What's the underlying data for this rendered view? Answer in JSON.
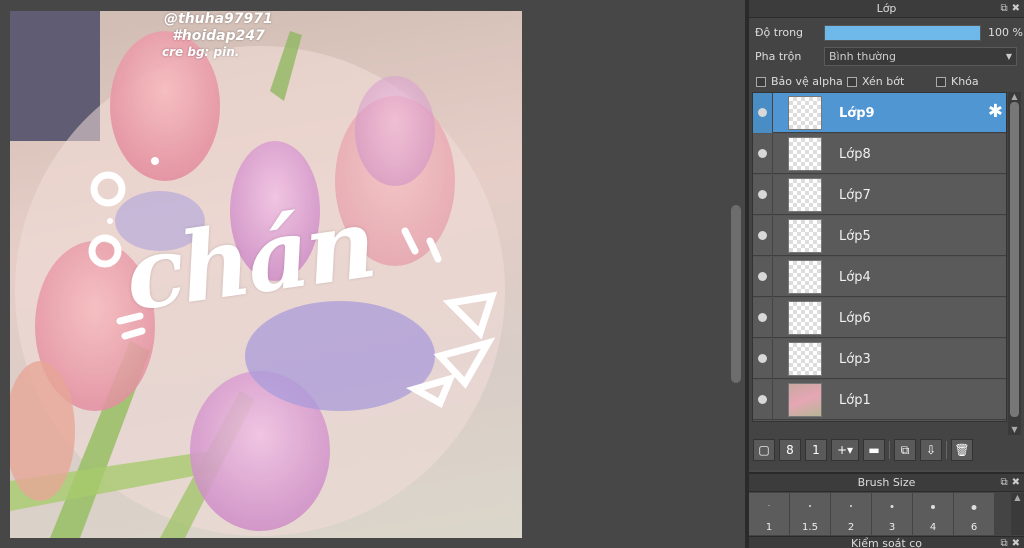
{
  "canvas": {
    "watermark": {
      "line1": "@thuha97971",
      "line2": "#hoidap247",
      "line3": "cre bg: pin."
    },
    "sticker_text": "chán"
  },
  "layer_panel": {
    "title": "Lớp",
    "opacity_label": "Độ trong",
    "opacity_value": "100 %",
    "opacity_level": 1.0,
    "blend_label": "Pha trộn",
    "blend_value": "Bình thường",
    "checkbox_alpha": "Bảo vệ alpha",
    "checkbox_clip": "Xén bớt",
    "checkbox_lock": "Khóa",
    "layers": [
      {
        "name": "Lớp9",
        "selected": true
      },
      {
        "name": "Lớp8",
        "selected": false
      },
      {
        "name": "Lớp7",
        "selected": false
      },
      {
        "name": "Lớp5",
        "selected": false
      },
      {
        "name": "Lớp4",
        "selected": false
      },
      {
        "name": "Lớp6",
        "selected": false
      },
      {
        "name": "Lớp3",
        "selected": false
      },
      {
        "name": "Lớp1",
        "selected": false
      }
    ],
    "toolbar_icons": [
      "new-layer-icon",
      "new-8bit-layer-icon",
      "new-1bit-layer-icon",
      "add-layer-menu-icon",
      "folder-icon",
      "duplicate-layer-icon",
      "merge-layer-icon",
      "delete-layer-icon"
    ]
  },
  "brush_panel": {
    "title": "Brush Size",
    "sizes": [
      "1",
      "1.5",
      "2",
      "3",
      "4",
      "6"
    ]
  },
  "control_panel": {
    "title": "Kiểm soát cọ"
  },
  "colors": {
    "accent": "#4f96d2",
    "opacity_fill": "#6fb9ea",
    "panel_bg": "#444444"
  }
}
